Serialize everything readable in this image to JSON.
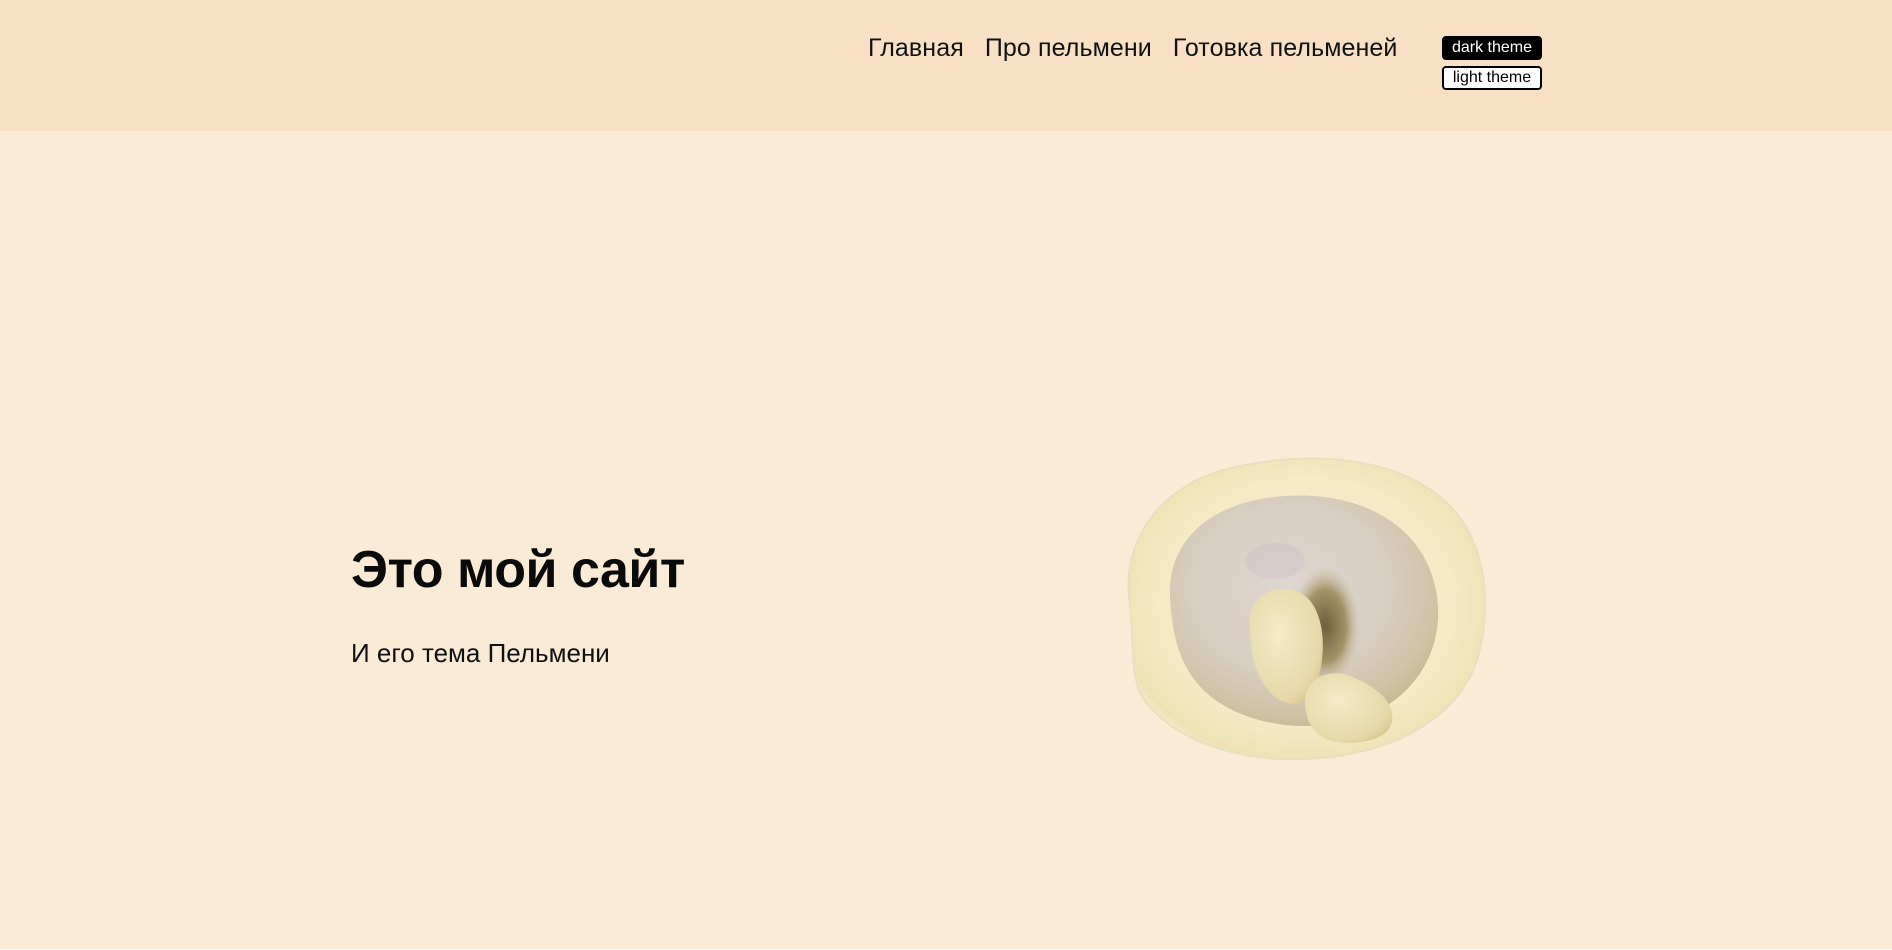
{
  "header": {
    "background": "#f8e0c5",
    "nav": [
      {
        "label": "Главная"
      },
      {
        "label": "Про пельмени"
      },
      {
        "label": "Готовка пельменей"
      }
    ],
    "theme_buttons": {
      "dark_label": "dark theme",
      "light_label": "light theme"
    }
  },
  "hero": {
    "background": "#faebd6",
    "title": "Это мой сайт",
    "subtitle": "И его тема Пельмени",
    "image": "dumpling-photo"
  }
}
